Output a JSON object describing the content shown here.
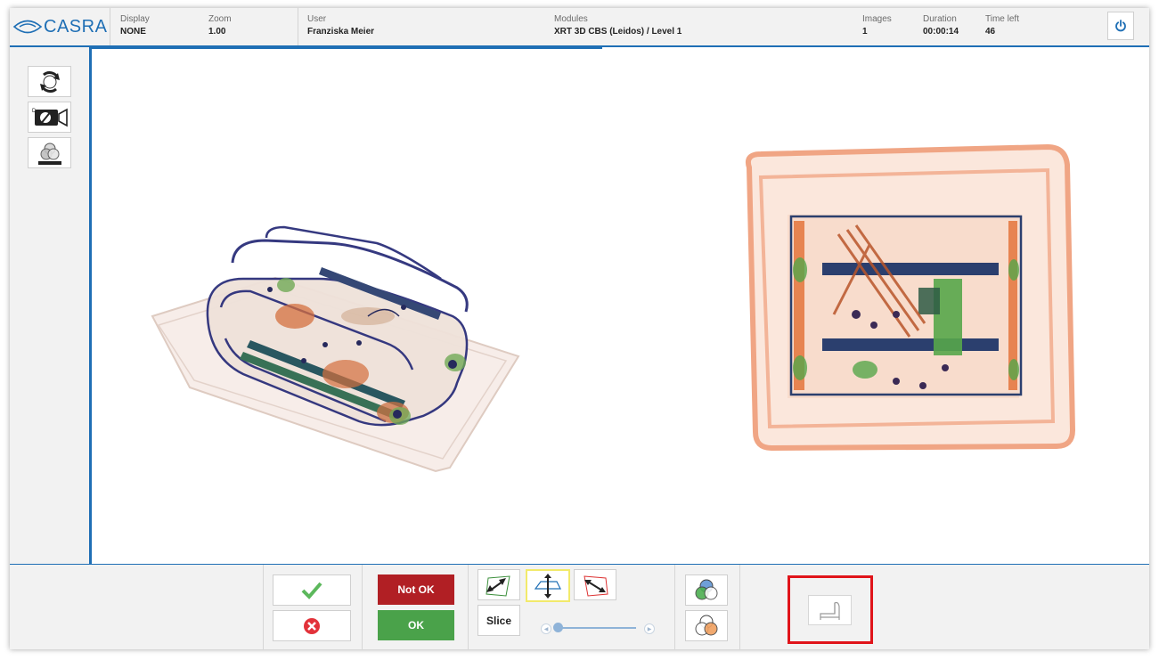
{
  "app": {
    "logo_text": "CASRA"
  },
  "header": {
    "display": {
      "label": "Display",
      "value": "NONE"
    },
    "zoom": {
      "label": "Zoom",
      "value": "1.00"
    },
    "user": {
      "label": "User",
      "value": "Franziska Meier"
    },
    "modules": {
      "label": "Modules",
      "value": "XRT 3D CBS (Leidos) / Level 1"
    },
    "images": {
      "label": "Images",
      "value": "1"
    },
    "duration": {
      "label": "Duration",
      "value": "00:00:14"
    },
    "time_left": {
      "label": "Time left",
      "value": "46"
    },
    "power_icon": "power-icon"
  },
  "sidebar": {
    "tools": [
      {
        "icon": "rotate-icon"
      },
      {
        "icon": "camera-icon"
      },
      {
        "icon": "material-filter-icon"
      }
    ]
  },
  "viewer": {
    "left_view": "3d-xray-view",
    "right_view": "top-xray-view",
    "slider_level": 0.12
  },
  "bottom_bar": {
    "accept_icon": "checkmark-icon",
    "reject_icon": "reject-icon",
    "not_ok_label": "Not OK",
    "ok_label": "OK",
    "slice_label": "Slice",
    "view_icons": [
      "rotate-left-icon",
      "vertical-flip-icon",
      "rotate-right-icon"
    ],
    "color_icons": [
      "color-mode-1-icon",
      "color-mode-2-icon"
    ],
    "extra_icon": "bag-outline-icon",
    "slice_level": 0.1
  },
  "colors": {
    "accent": "#1f6fb5",
    "not_ok": "#b11f24",
    "ok": "#4aa24a",
    "highlight": "#e0141a"
  }
}
